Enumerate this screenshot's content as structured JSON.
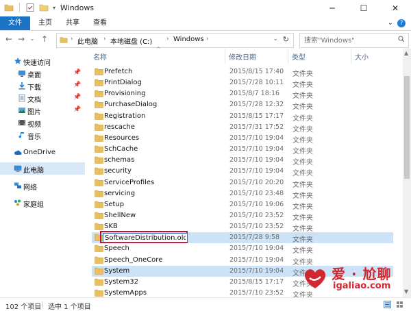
{
  "window": {
    "title": "Windows",
    "minimize": "─",
    "maximize": "☐",
    "close": "✕"
  },
  "ribbon": {
    "tabs": [
      "文件",
      "主页",
      "共享",
      "查看"
    ],
    "help": "?"
  },
  "address": {
    "crumbs": [
      "此电脑",
      "本地磁盘 (C:)",
      "Windows"
    ],
    "search_placeholder": "搜索\"Windows\""
  },
  "sidebar": {
    "items": [
      {
        "label": "快速访问",
        "icon": "star-icon"
      },
      {
        "label": "桌面",
        "icon": "desktop-icon",
        "pinned": true
      },
      {
        "label": "下载",
        "icon": "download-icon",
        "pinned": true
      },
      {
        "label": "文档",
        "icon": "document-icon",
        "pinned": true
      },
      {
        "label": "图片",
        "icon": "picture-icon",
        "pinned": true
      },
      {
        "label": "视频",
        "icon": "video-icon"
      },
      {
        "label": "音乐",
        "icon": "music-icon"
      },
      {
        "label": "OneDrive",
        "icon": "cloud-icon"
      },
      {
        "label": "此电脑",
        "icon": "computer-icon",
        "selected": true
      },
      {
        "label": "网络",
        "icon": "network-icon"
      },
      {
        "label": "家庭组",
        "icon": "homegroup-icon"
      }
    ]
  },
  "columns": {
    "name": "名称",
    "date": "修改日期",
    "type": "类型",
    "size": "大小"
  },
  "files": [
    {
      "name": "Prefetch",
      "date": "2015/8/15 17:40",
      "type": "文件夹"
    },
    {
      "name": "PrintDialog",
      "date": "2015/7/28 10:11",
      "type": "文件夹"
    },
    {
      "name": "Provisioning",
      "date": "2015/8/7 18:16",
      "type": "文件夹"
    },
    {
      "name": "PurchaseDialog",
      "date": "2015/7/28 12:32",
      "type": "文件夹"
    },
    {
      "name": "Registration",
      "date": "2015/8/15 17:17",
      "type": "文件夹"
    },
    {
      "name": "rescache",
      "date": "2015/7/31 17:52",
      "type": "文件夹"
    },
    {
      "name": "Resources",
      "date": "2015/7/10 19:04",
      "type": "文件夹"
    },
    {
      "name": "SchCache",
      "date": "2015/7/10 19:04",
      "type": "文件夹"
    },
    {
      "name": "schemas",
      "date": "2015/7/10 19:04",
      "type": "文件夹"
    },
    {
      "name": "security",
      "date": "2015/7/10 19:04",
      "type": "文件夹"
    },
    {
      "name": "ServiceProfiles",
      "date": "2015/7/10 20:20",
      "type": "文件夹"
    },
    {
      "name": "servicing",
      "date": "2015/7/10 23:48",
      "type": "文件夹"
    },
    {
      "name": "Setup",
      "date": "2015/7/10 19:06",
      "type": "文件夹"
    },
    {
      "name": "ShellNew",
      "date": "2015/7/10 23:52",
      "type": "文件夹"
    },
    {
      "name": "SKB",
      "date": "2015/7/10 23:52",
      "type": "文件夹"
    },
    {
      "name": "SoftwareDistribution.old",
      "date": "2015/7/28 9:58",
      "type": "文件夹",
      "renaming": true
    },
    {
      "name": "Speech",
      "date": "2015/7/10 19:04",
      "type": "文件夹"
    },
    {
      "name": "Speech_OneCore",
      "date": "2015/7/10 19:04",
      "type": "文件夹"
    },
    {
      "name": "System",
      "date": "2015/7/10 19:04",
      "type": "文件夹",
      "hover": true
    },
    {
      "name": "System32",
      "date": "2015/8/15 17:17",
      "type": "文件夹"
    },
    {
      "name": "SystemApps",
      "date": "2015/7/10 23:52",
      "type": "文件夹"
    }
  ],
  "status": {
    "count": "102 个项目",
    "selected": "选中 1 个项目"
  },
  "watermark": {
    "brand": "爱 · 尬聊",
    "url": "igaliao.com"
  },
  "colors": {
    "accent": "#1a73c7",
    "selection": "#cce3f7",
    "folder": "#e8c062",
    "highlight_box": "#c8102e",
    "watermark": "#d1282f"
  }
}
